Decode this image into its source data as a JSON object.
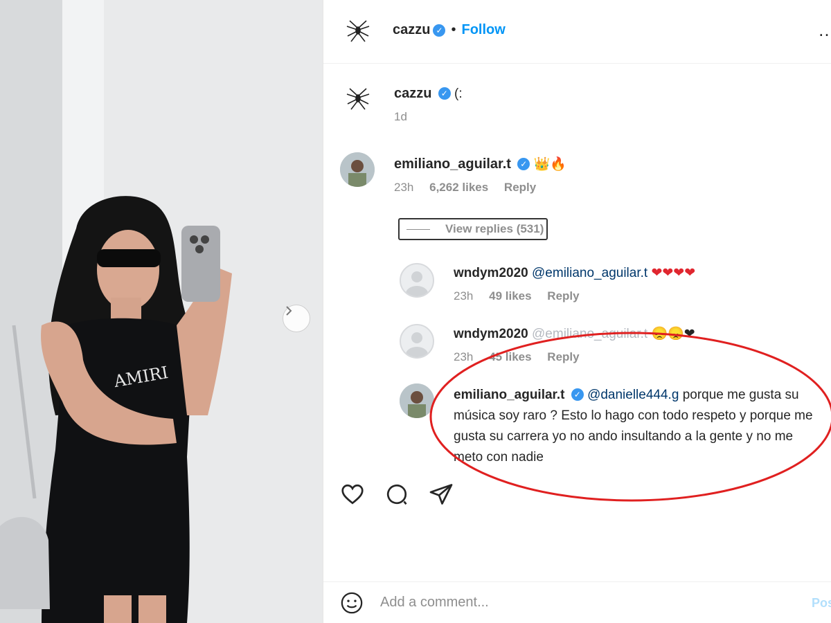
{
  "post": {
    "author": "cazzu",
    "follow_label": "Follow",
    "dot": "•",
    "more": "…"
  },
  "caption": {
    "username": "cazzu",
    "text": "(:",
    "time": "1d"
  },
  "comments": [
    {
      "username": "emiliano_aguilar.t",
      "text": "👑🔥",
      "time": "23h",
      "likes": "6,262 likes",
      "reply_label": "Reply",
      "view_replies": "View replies (531)"
    }
  ],
  "replies": [
    {
      "username": "wndym2020",
      "mention": "@emiliano_aguilar.t",
      "text": "❤❤❤❤",
      "time": "23h",
      "likes": "49 likes",
      "reply_label": "Reply"
    },
    {
      "username": "wndym2020",
      "mention": "@emiliano_aguilar.t",
      "text": "😞😞❤",
      "time": "23h",
      "likes": "45 likes",
      "reply_label": "Reply"
    },
    {
      "username": "emiliano_aguilar.t",
      "mention": "@danielle444.g",
      "text": "porque me gusta su música soy raro ? Esto lo hago con todo respeto y porque me gusta su carrera yo no ando insultando a la gente y no me meto con nadie"
    }
  ],
  "footer": {
    "placeholder": "Add a comment...",
    "post_label": "Post"
  },
  "colors": {
    "link_blue": "#0095f6",
    "verified_blue": "#3897f0",
    "highlight_red": "#e02020",
    "muted": "#8e8e8e"
  },
  "icons": [
    "chevron-right-icon",
    "heart-icon",
    "comment-icon",
    "share-icon",
    "emoji-icon",
    "spider-icon",
    "verified-icon"
  ]
}
